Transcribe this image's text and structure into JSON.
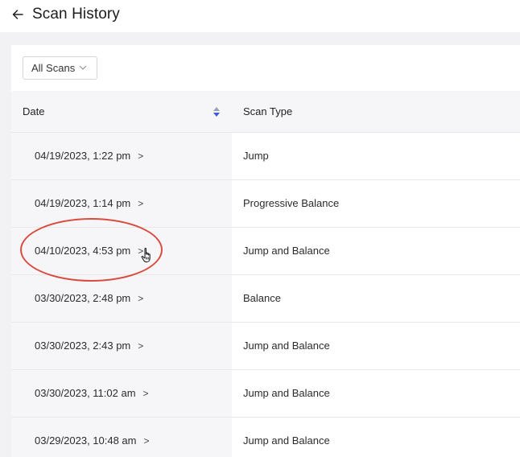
{
  "header": {
    "title": "Scan History",
    "back_icon": "arrow-left-icon"
  },
  "filter": {
    "label": "All Scans",
    "icon": "chevron-down-icon"
  },
  "table": {
    "columns": {
      "date": "Date",
      "scan_type": "Scan Type"
    },
    "sort_icon": "sort-icon",
    "row_arrow": ">",
    "rows": [
      {
        "date": "04/19/2023, 1:22 pm",
        "scan_type": "Jump"
      },
      {
        "date": "04/19/2023, 1:14 pm",
        "scan_type": "Progressive Balance"
      },
      {
        "date": "04/10/2023, 4:53 pm",
        "scan_type": "Jump and Balance"
      },
      {
        "date": "03/30/2023, 2:48 pm",
        "scan_type": "Balance"
      },
      {
        "date": "03/30/2023, 2:43 pm",
        "scan_type": "Jump and Balance"
      },
      {
        "date": "03/30/2023, 11:02 am",
        "scan_type": "Jump and Balance"
      },
      {
        "date": "03/29/2023, 10:48 am",
        "scan_type": "Jump and Balance"
      }
    ]
  },
  "annotation": {
    "highlight_color": "#d94a3f",
    "cursor_icon": "hand-pointer-icon"
  },
  "colors": {
    "page_background": "#f2f2f5",
    "sort_accent": "#3b5bdb"
  }
}
